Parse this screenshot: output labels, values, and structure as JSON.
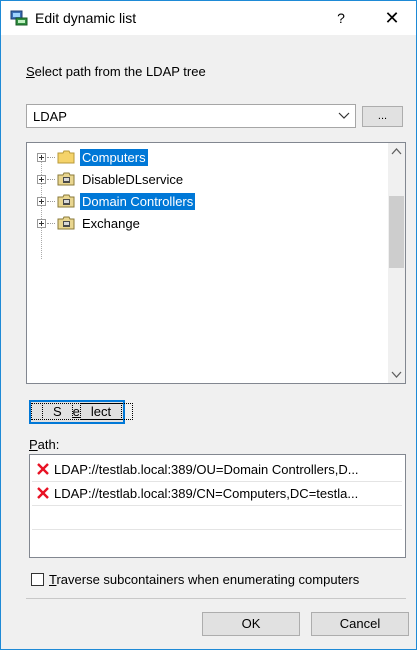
{
  "window": {
    "title": "Edit dynamic list",
    "help": "?",
    "close": "✕"
  },
  "ldap_section": {
    "label_prefix": "S",
    "label_rest": "elect path from the LDAP tree",
    "combo_value": "LDAP",
    "browse_label": "..."
  },
  "tree": {
    "items": [
      {
        "label": "Computers",
        "selected": true,
        "icon": "folder-icon"
      },
      {
        "label": "DisableDLservice",
        "selected": false,
        "icon": "ou-folder-icon"
      },
      {
        "label": "Domain Controllers",
        "selected": true,
        "icon": "ou-folder-icon"
      },
      {
        "label": "Exchange",
        "selected": false,
        "icon": "ou-folder-icon"
      }
    ]
  },
  "select_button": {
    "prefix": "S",
    "underlined": "e",
    "rest": "lect"
  },
  "path_section": {
    "label_underlined": "P",
    "label_rest": "ath:",
    "items": [
      "LDAP://testlab.local:389/OU=Domain Controllers,D...",
      "LDAP://testlab.local:389/CN=Computers,DC=testla..."
    ]
  },
  "traverse": {
    "underlined": "T",
    "rest": "raverse subcontainers when enumerating computers",
    "checked": false
  },
  "buttons": {
    "ok": "OK",
    "cancel": "Cancel"
  },
  "colors": {
    "selection": "#0078d7",
    "error_x": "#e81123",
    "border_accent": "#1e8ad6"
  }
}
